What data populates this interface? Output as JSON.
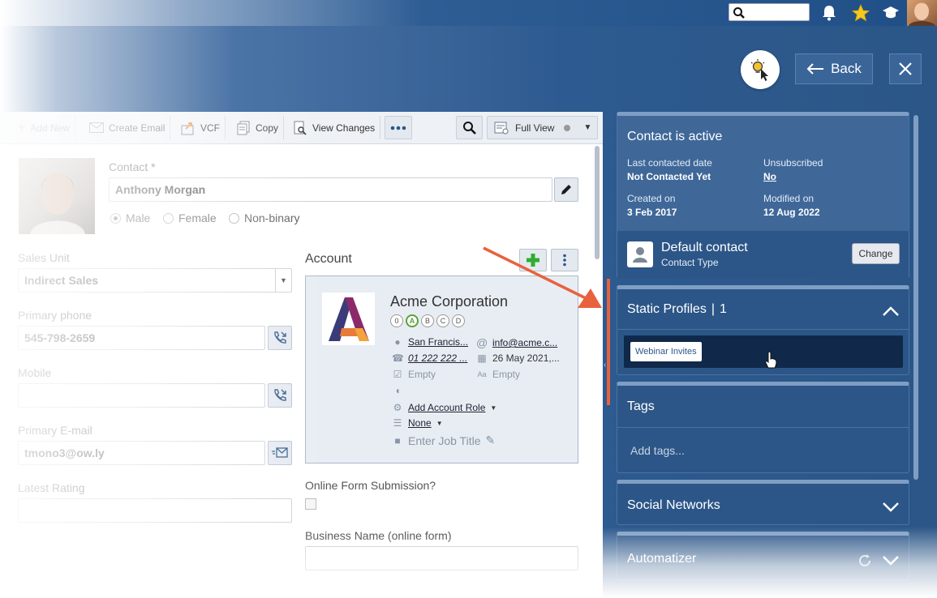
{
  "colors": {
    "accent": "#2b5687",
    "arrow": "#e8623e",
    "plus": "#2fae2f"
  },
  "toolbar": {
    "add_new": "Add New",
    "create_email": "Create Email",
    "vcf": "VCF",
    "copy": "Copy",
    "view_changes": "View Changes",
    "full_view": "Full View"
  },
  "contact": {
    "label": "Contact *",
    "name": "Anthony Morgan",
    "gender_options": [
      "Male",
      "Female",
      "Non-binary"
    ],
    "sales_unit_label": "Sales Unit",
    "sales_unit_value": "Indirect Sales",
    "primary_phone_label": "Primary phone",
    "primary_phone_value": "545-798-2659",
    "mobile_label": "Mobile",
    "email_label": "Primary E-mail",
    "email_value": "tmono3@ow.ly",
    "rating_label": "Latest Rating"
  },
  "account": {
    "label": "Account",
    "name": "Acme Corporation",
    "ratings": [
      "0",
      "A",
      "B",
      "C",
      "D"
    ],
    "city": "San Francis...",
    "email": "info@acme.c...",
    "phone": "01 222 222 ...",
    "date": "26 May 2021,...",
    "empty1": "Empty",
    "empty2": "Empty",
    "add_role": "Add Account Role",
    "none": "None",
    "job_title": "Enter Job Title"
  },
  "form": {
    "online_submission_label": "Online Form Submission?",
    "business_name_label": "Business Name (online form)"
  },
  "header": {
    "back": "Back"
  },
  "status": {
    "title": "Contact is active",
    "last_contacted_label": "Last contacted date",
    "last_contacted_value": "Not Contacted Yet",
    "unsubscribed_label": "Unsubscribed",
    "unsubscribed_value": "No",
    "created_label": "Created on",
    "created_value": "3 Feb 2017",
    "modified_label": "Modified on",
    "modified_value": "12 Aug 2022",
    "type_name": "Default contact",
    "type_label": "Contact Type",
    "change": "Change"
  },
  "static_profiles": {
    "title": "Static Profiles",
    "count": "1",
    "items": [
      "Webinar Invites"
    ]
  },
  "tags": {
    "title": "Tags",
    "placeholder": "Add tags..."
  },
  "social": {
    "title": "Social Networks"
  },
  "automatizer": {
    "title": "Automatizer"
  }
}
